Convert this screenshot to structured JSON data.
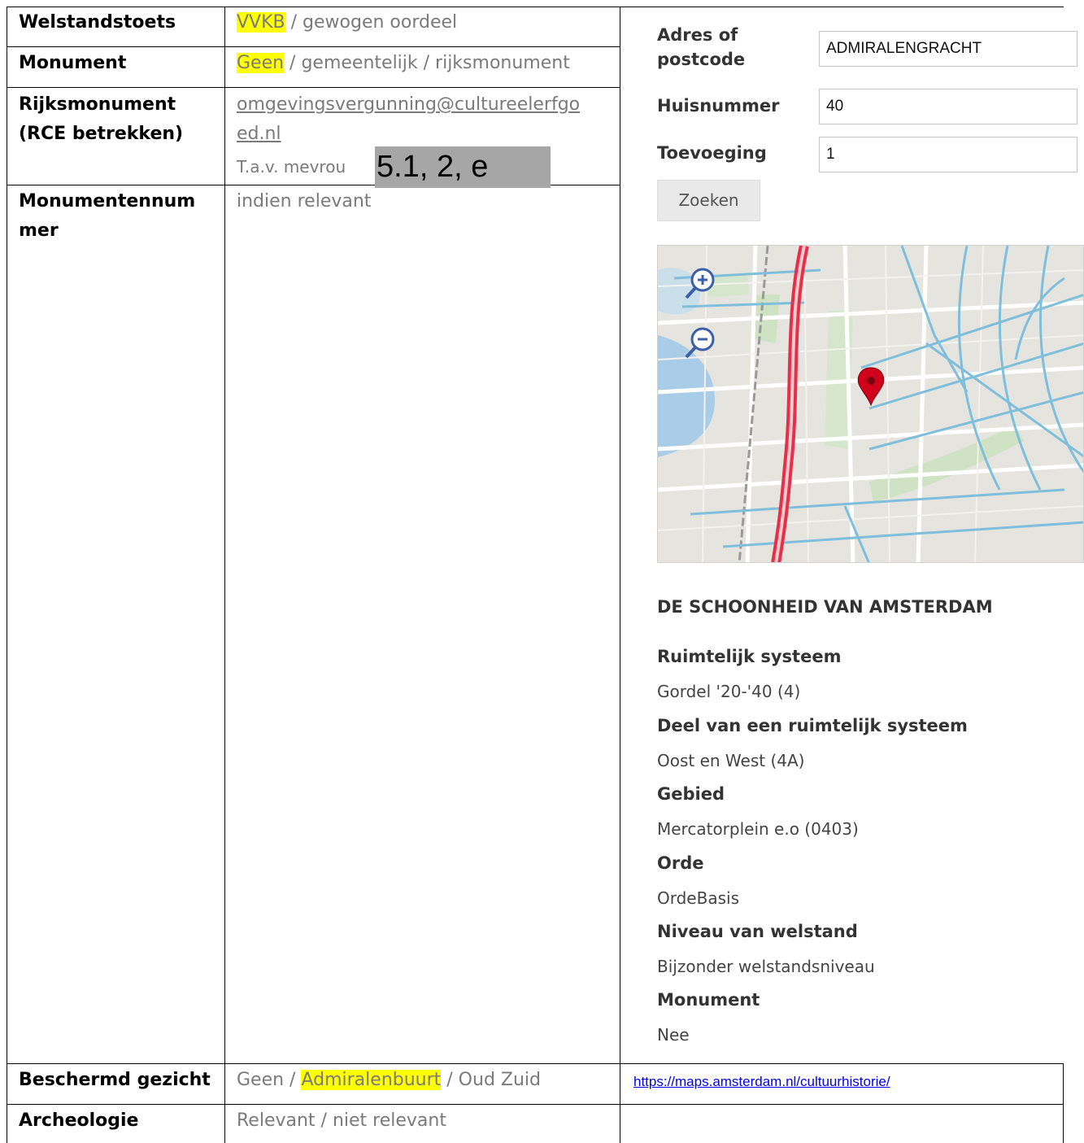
{
  "table": {
    "rows": [
      {
        "label": "Welstandstoets",
        "highlight": "VVKB",
        "rest": " / gewogen oordeel"
      },
      {
        "label": "Monument",
        "highlight": "Geen",
        "rest": " / gemeentelijk / rijksmonument"
      },
      {
        "label_line1": "Rijksmonument",
        "label_line2": "(RCE betrekken)",
        "email_line1": "omgevingsvergunning@cultureelerfgo",
        "email_line2": "ed.nl",
        "tav": "T.a.v. mevrou",
        "redaction": "5.1, 2, e"
      },
      {
        "label_line1": "Monumentennum",
        "label_line2": "mer",
        "value": "indien relevant"
      },
      {
        "label": "Beschermd gezicht",
        "pre": "Geen / ",
        "highlight": "Admiralenbuurt",
        "rest": " / Oud Zuid",
        "link": "https://maps.amsterdam.nl/cultuurhistorie/"
      },
      {
        "label": "Archeologie",
        "value": "Relevant / niet relevant"
      }
    ]
  },
  "search": {
    "address_label_1": "Adres of",
    "address_label_2": "postcode",
    "address_value": "ADMIRALENGRACHT",
    "number_label": "Huisnummer",
    "number_value": "40",
    "suffix_label": "Toevoeging",
    "suffix_value": "1",
    "button_label": "Zoeken"
  },
  "map": {
    "zoom_in": "+",
    "zoom_out": "−"
  },
  "info": {
    "title": "DE SCHOONHEID VAN AMSTERDAM",
    "items": [
      {
        "label": "Ruimtelijk systeem",
        "value": "Gordel '20-'40 (4)"
      },
      {
        "label": "Deel van een ruimtelijk systeem",
        "value": "Oost en West (4A)"
      },
      {
        "label": "Gebied",
        "value": "Mercatorplein e.o (0403)"
      },
      {
        "label": "Orde",
        "value": "OrdeBasis"
      },
      {
        "label": "Niveau van welstand",
        "value": "Bijzonder welstandsniveau"
      },
      {
        "label": "Monument",
        "value": "Nee"
      }
    ]
  },
  "colors": {
    "highlight": "#ffff00",
    "value_gray": "#7a7a7a",
    "link_blue": "#0000ee",
    "pin_red": "#d0021b"
  }
}
